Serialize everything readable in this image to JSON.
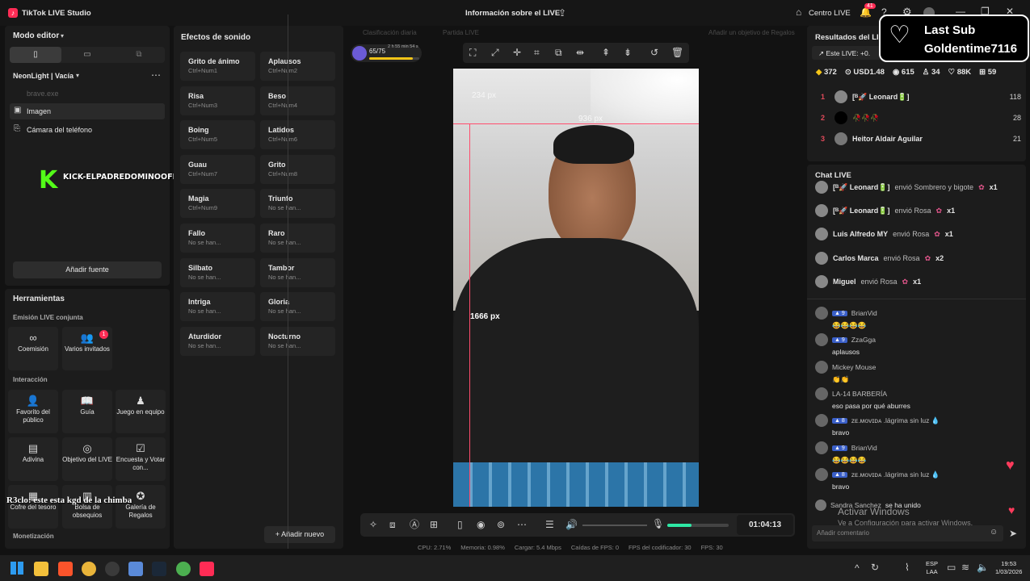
{
  "app": {
    "title": "TikTok LIVE Studio",
    "live_info": "Información sobre el LIVE",
    "centro": "Centro LIVE",
    "notif_count": "41"
  },
  "left": {
    "mode": "Modo editor",
    "scene": "NeonLight | Vacía",
    "sources": [
      "brave.exe",
      "Imagen",
      "Cámara del teléfono"
    ],
    "overlay_text": "KICK-ELPADREDOMINOOFICIALL",
    "add_source": "Añadir fuente",
    "tools_title": "Herramientas",
    "joint_title": "Emisión LIVE conjunta",
    "coemision": "Coemisión",
    "invitados": "Varios invitados",
    "invitados_badge": "1",
    "interaccion_title": "Interacción",
    "tools": [
      "Favorito del público",
      "Guía",
      "Juego en equipo",
      "Adivina",
      "Objetivo del LIVE",
      "Encuesta y Votar con...",
      "Cofre del tesoro",
      "Bolsa de obsequios",
      "Galería de Regalos"
    ],
    "monet_title": "Monetización",
    "caption": "R3clo: este esta kgd de la chimba"
  },
  "sounds": {
    "title": "Efectos de sonido",
    "items": [
      {
        "n": "Grito de ánimo",
        "k": "Ctrl+Num1"
      },
      {
        "n": "Aplausos",
        "k": "Ctrl+Num2"
      },
      {
        "n": "Risa",
        "k": "Ctrl+Num3"
      },
      {
        "n": "Beso",
        "k": "Ctrl+Num4"
      },
      {
        "n": "Boing",
        "k": "Ctrl+Num5"
      },
      {
        "n": "Latidos",
        "k": "Ctrl+Num6"
      },
      {
        "n": "Guau",
        "k": "Ctrl+Num7"
      },
      {
        "n": "Grito",
        "k": "Ctrl+Num8"
      },
      {
        "n": "Magia",
        "k": "Ctrl+Num9"
      },
      {
        "n": "Triunfo",
        "k": "No se han..."
      },
      {
        "n": "Fallo",
        "k": "No se han..."
      },
      {
        "n": "Raro",
        "k": "No se han..."
      },
      {
        "n": "Silbato",
        "k": "No se han..."
      },
      {
        "n": "Tambor",
        "k": "No se han..."
      },
      {
        "n": "Intriga",
        "k": "No se han..."
      },
      {
        "n": "Gloria",
        "k": "No se han..."
      },
      {
        "n": "Aturdidor",
        "k": "No se han..."
      },
      {
        "n": "Nocturno",
        "k": "No se han..."
      }
    ],
    "add_new": "Añadir nuevo"
  },
  "center": {
    "ranking": "Clasificación diaria",
    "match": "Partida LIVE",
    "goal": "Añadir un objetivo de Regalos",
    "progress": "65/75",
    "progress_value": 0.87,
    "timer_small": "2 h 55 min 54 s",
    "dim_top": "234 px",
    "dim_width": "936 px",
    "dim_height": "1666 px",
    "live_time": "01:04:13",
    "mic_level": 0.4
  },
  "stats": {
    "cpu": "CPU:  2.71%",
    "mem": "Memoria:  0.98%",
    "load": "Cargar:  5.4 Mbps",
    "fps_drop": "Caídas de FPS:  0",
    "enc_fps": "FPS del codificador:  30",
    "fps": "FPS:  30"
  },
  "right": {
    "results_title": "Resultados del LI",
    "este_live": "Este LIVE: +0.",
    "last_sub": "Last Sub",
    "sub_name": "Goldentime7116",
    "metrics": [
      "372",
      "USD1.48",
      "615",
      "34",
      "88K",
      "59"
    ],
    "ranks": [
      {
        "n": "1",
        "name": "[ᴮ🚀 Leonard🔋]",
        "v": "118"
      },
      {
        "n": "2",
        "name": "🥀🥀🥀",
        "v": "28"
      },
      {
        "n": "3",
        "name": "Heitor Aldair Aguilar",
        "v": "21"
      }
    ],
    "chat_title": "Chat LIVE",
    "gifts": [
      {
        "user": "[ᴮ🚀 Leonard🔋]",
        "msg": "envió Sombrero y bigote",
        "x": "x1"
      },
      {
        "user": "[ᴮ🚀 Leonard🔋]",
        "msg": "envió Rosa",
        "x": "x1"
      },
      {
        "user": "Luis Alfredo MY",
        "msg": "envió Rosa",
        "x": "x1"
      },
      {
        "user": "Carlos Marca",
        "msg": "envió Rosa",
        "x": "x2"
      },
      {
        "user": "Miguel",
        "msg": "envió Rosa",
        "x": "x1"
      }
    ],
    "messages": [
      {
        "lvl": "9",
        "user": "BrianVid",
        "text": "😂😂😂😂"
      },
      {
        "lvl": "9",
        "user": "ZzaGga",
        "text": "aplausos"
      },
      {
        "lvl": "",
        "user": "Mickey Mouse",
        "text": "👏👏"
      },
      {
        "lvl": "",
        "user": "LA-14 BARBERÍA",
        "text": "eso pasa por qué aburres"
      },
      {
        "lvl": "8",
        "user": "ᴢᴇ.ᴍᴏᴠɪᴅᴀ .lágrima sin luz 💧",
        "text": "bravo"
      },
      {
        "lvl": "9",
        "user": "BrianVid",
        "text": "😂😂😂😂"
      },
      {
        "lvl": "8",
        "user": "ᴢᴇ.ᴍᴏᴠɪᴅᴀ .lágrima sin luz 💧",
        "text": "bravo"
      }
    ],
    "joined_user": "Sandra Sanchez",
    "joined": "se ha unido",
    "activate1": "Activar Windows",
    "activate2": "Ve a Configuración para activar Windows.",
    "comment_placeholder": "Añadir comentario"
  },
  "taskbar": {
    "lang1": "ESP",
    "lang2": "LAA",
    "time": "19:53",
    "date": "1/03/2026"
  },
  "colors": {
    "accent": "#fe2c55",
    "bg": "#121212",
    "panel": "#1c1c1c"
  }
}
